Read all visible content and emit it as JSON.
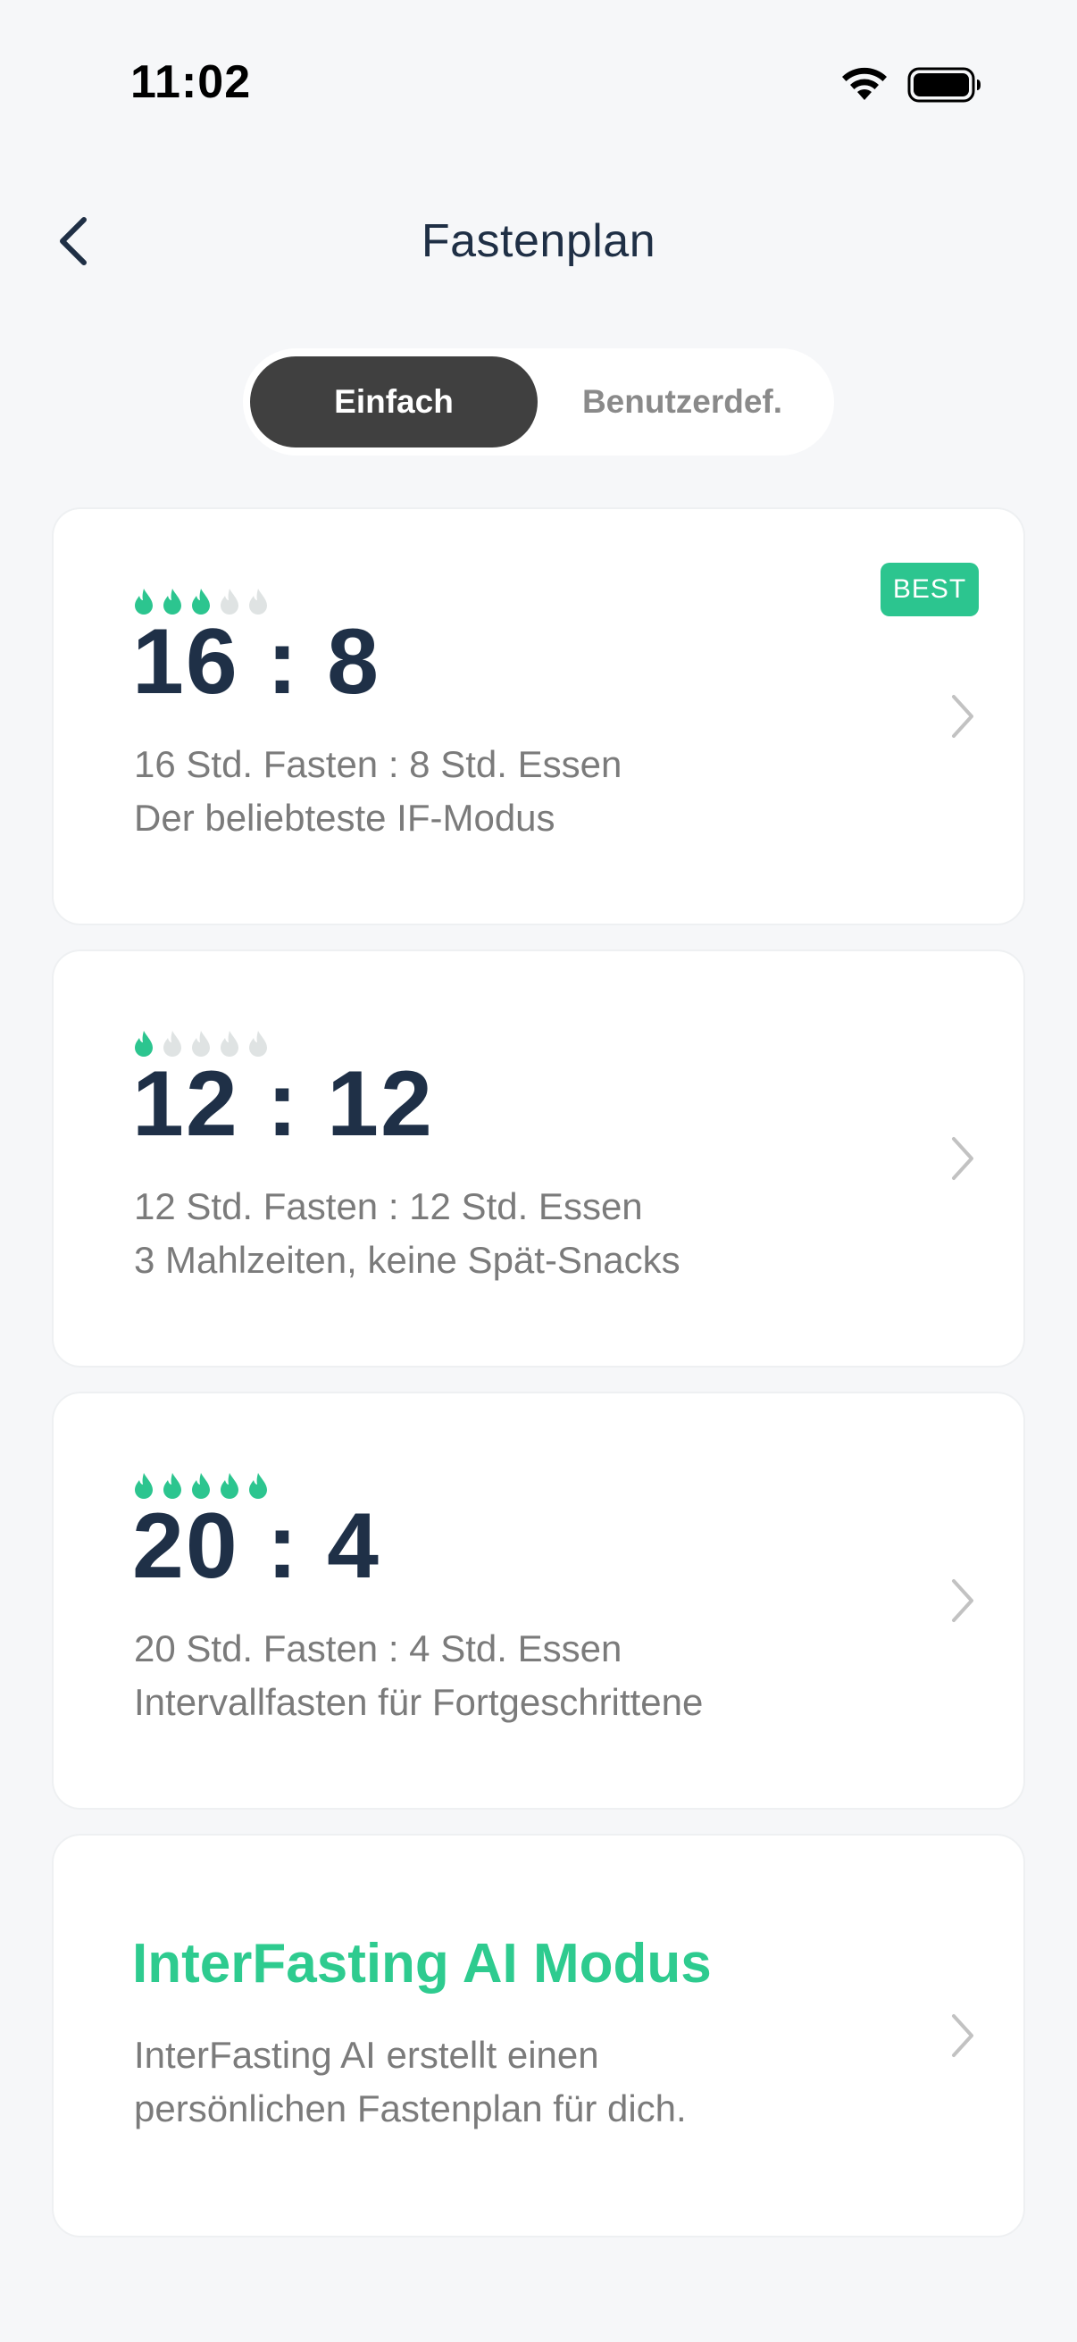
{
  "status_bar": {
    "time": "11:02"
  },
  "nav": {
    "title": "Fastenplan"
  },
  "segmented": {
    "options": [
      "Einfach",
      "Benutzerdef."
    ],
    "selected": "Einfach"
  },
  "plans": [
    {
      "difficulty": 3,
      "difficulty_max": 5,
      "ratio_left": "16",
      "ratio_sep": ":",
      "ratio_right": "8",
      "line1": "16 Std. Fasten : 8 Std. Essen",
      "line2": "Der beliebteste IF-Modus",
      "badge": "BEST"
    },
    {
      "difficulty": 1,
      "difficulty_max": 5,
      "ratio_left": "12",
      "ratio_sep": ":",
      "ratio_right": "12",
      "line1": "12 Std. Fasten : 12 Std. Essen",
      "line2": "3 Mahlzeiten, keine Spät-Snacks"
    },
    {
      "difficulty": 5,
      "difficulty_max": 5,
      "ratio_left": "20",
      "ratio_sep": ":",
      "ratio_right": "4",
      "line1": "20 Std. Fasten : 4 Std. Essen",
      "line2": "Intervallfasten für Fortgeschrittene"
    }
  ],
  "ai_card": {
    "title": "InterFasting AI Modus",
    "line1": "InterFasting AI erstellt einen",
    "line2": "persönlichen Fastenplan für dich."
  },
  "colors": {
    "accent_green": "#2cc58f",
    "drop_inactive": "#dfe3e3",
    "title_dark": "#1f3047",
    "segment_active": "#404040"
  },
  "icons": {
    "back": "chevron-left-icon",
    "row": "chevron-right-icon",
    "difficulty": "flame-drop-icon"
  }
}
